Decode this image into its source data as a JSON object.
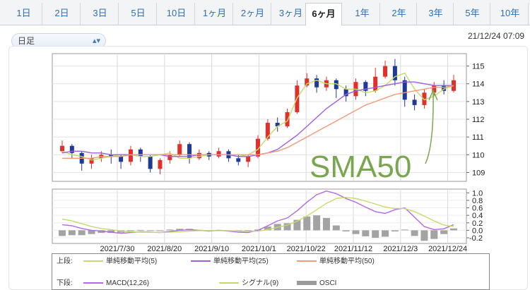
{
  "tabs": [
    {
      "label": "1日"
    },
    {
      "label": "2日"
    },
    {
      "label": "3日"
    },
    {
      "label": "5日"
    },
    {
      "label": "10日"
    },
    {
      "label": "1ヶ月"
    },
    {
      "label": "2ヶ月"
    },
    {
      "label": "3ヶ月"
    },
    {
      "label": "6ヶ月",
      "active": true
    },
    {
      "label": "1年"
    },
    {
      "label": "2年"
    },
    {
      "label": "3年"
    },
    {
      "label": "5年"
    },
    {
      "label": "10年"
    }
  ],
  "selector": {
    "value": "日足",
    "icon": "chevron-updown-icon"
  },
  "datetime": "21/12/24 07:09",
  "annotation": "SMA50",
  "legend": {
    "upper_label": "上段:",
    "lower_label": "下段:",
    "upper_items": [
      {
        "label": "単純移動平均(5)",
        "color": "#c6d96a"
      },
      {
        "label": "単純移動平均(25)",
        "color": "#9b5fe0"
      },
      {
        "label": "単純移動平均(50)",
        "color": "#f29a7a"
      }
    ],
    "lower_items": [
      {
        "label": "MACD(12,26)",
        "color": "#b36ae6"
      },
      {
        "label": "シグナル(9)",
        "color": "#c6d96a"
      },
      {
        "label": "OSCI",
        "color": "#9a9a9a"
      }
    ]
  },
  "colors": {
    "up": "#e0302a",
    "down": "#1f3a96",
    "accent": "#2f6fb5",
    "annotation": "#7aa64f"
  },
  "chart_data": [
    {
      "type": "candlestick",
      "x": [
        "2021/7/30",
        "2021/8/20",
        "2021/9/10",
        "2021/10/1",
        "2021/10/22",
        "2021/11/12",
        "2021/12/3",
        "2021/12/24"
      ],
      "ylim": [
        108.5,
        115.7
      ],
      "yticks": [
        109,
        110,
        111,
        112,
        113,
        114,
        115
      ],
      "series": [
        {
          "name": "単純移動平均(5)",
          "values": [
            110.2,
            110.0,
            109.9,
            109.7,
            109.8,
            109.9,
            110.0,
            110.0,
            109.9,
            109.9,
            110.0,
            110.1,
            109.8,
            109.8,
            109.9,
            110.0,
            110.0,
            110.0,
            109.9,
            110.0,
            110.3,
            111.0,
            111.6,
            111.9,
            113.2,
            114.0,
            114.2,
            114.0,
            114.0,
            113.7,
            113.7,
            113.5,
            113.6,
            113.9,
            114.4,
            114.6,
            113.7,
            113.1,
            113.3,
            113.7,
            113.9
          ]
        },
        {
          "name": "単純移動平均(25)",
          "values": [
            110.1,
            110.2,
            110.2,
            110.1,
            110.1,
            110.0,
            110.0,
            110.0,
            110.0,
            110.0,
            110.0,
            109.9,
            109.9,
            109.9,
            110.0,
            110.0,
            110.0,
            110.0,
            109.9,
            109.9,
            110.0,
            110.1,
            110.3,
            110.7,
            111.1,
            111.6,
            112.1,
            112.6,
            113.0,
            113.4,
            113.6,
            113.7,
            113.8,
            113.9,
            114.0,
            114.1,
            114.1,
            114.0,
            113.9,
            113.9,
            113.9
          ]
        },
        {
          "name": "単純移動平均(50)",
          "values": [
            109.8,
            109.8,
            109.8,
            109.8,
            109.9,
            109.9,
            109.9,
            110.0,
            110.0,
            110.0,
            110.0,
            110.0,
            110.0,
            110.0,
            110.0,
            110.0,
            110.0,
            110.0,
            110.0,
            110.0,
            110.0,
            110.1,
            110.2,
            110.4,
            110.7,
            111.0,
            111.3,
            111.6,
            111.9,
            112.2,
            112.5,
            112.8,
            113.0,
            113.2,
            113.4,
            113.5,
            113.6,
            113.7,
            113.8,
            113.8,
            113.9
          ]
        }
      ],
      "candles": [
        [
          110.2,
          110.5,
          110.1,
          110.8
        ],
        [
          110.5,
          110.1,
          109.8,
          110.6
        ],
        [
          110.1,
          109.5,
          109.1,
          110.2
        ],
        [
          109.5,
          109.8,
          109.2,
          110.0
        ],
        [
          109.8,
          110.0,
          109.6,
          110.2
        ],
        [
          110.0,
          109.9,
          109.5,
          110.3
        ],
        [
          109.9,
          109.6,
          109.2,
          110.0
        ],
        [
          109.6,
          110.3,
          109.4,
          110.5
        ],
        [
          110.3,
          109.9,
          109.6,
          110.4
        ],
        [
          109.9,
          109.2,
          109.0,
          110.0
        ],
        [
          109.2,
          109.7,
          108.9,
          109.8
        ],
        [
          109.7,
          110.0,
          109.5,
          110.2
        ],
        [
          110.0,
          110.6,
          109.9,
          110.8
        ],
        [
          110.6,
          109.8,
          109.5,
          110.7
        ],
        [
          109.8,
          110.1,
          109.7,
          110.3
        ],
        [
          110.1,
          109.9,
          109.7,
          110.2
        ],
        [
          109.9,
          110.2,
          109.8,
          110.4
        ],
        [
          110.2,
          109.8,
          109.6,
          110.3
        ],
        [
          109.8,
          109.6,
          109.4,
          110.0
        ],
        [
          109.6,
          109.9,
          109.3,
          110.0
        ],
        [
          109.9,
          110.9,
          109.8,
          111.1
        ],
        [
          110.9,
          111.8,
          110.8,
          112.0
        ],
        [
          111.8,
          111.6,
          111.3,
          112.1
        ],
        [
          111.6,
          112.4,
          111.5,
          112.6
        ],
        [
          112.4,
          113.9,
          112.3,
          114.2
        ],
        [
          113.9,
          114.3,
          113.8,
          114.6
        ],
        [
          114.3,
          113.8,
          113.5,
          114.5
        ],
        [
          113.8,
          114.2,
          113.6,
          114.4
        ],
        [
          114.2,
          113.7,
          113.2,
          114.3
        ],
        [
          113.7,
          113.3,
          113.0,
          113.9
        ],
        [
          113.3,
          114.1,
          113.1,
          114.3
        ],
        [
          114.1,
          113.6,
          113.3,
          114.2
        ],
        [
          113.6,
          114.4,
          113.5,
          114.9
        ],
        [
          114.4,
          115.0,
          114.3,
          115.3
        ],
        [
          115.0,
          114.2,
          113.9,
          115.4
        ],
        [
          114.2,
          113.1,
          112.7,
          114.4
        ],
        [
          113.1,
          112.8,
          112.5,
          113.4
        ],
        [
          112.8,
          113.5,
          112.6,
          113.7
        ],
        [
          113.5,
          113.9,
          113.3,
          114.1
        ],
        [
          113.9,
          113.6,
          113.4,
          114.2
        ],
        [
          113.6,
          114.2,
          113.5,
          114.5
        ]
      ]
    },
    {
      "type": "line",
      "ylim": [
        -0.35,
        1.1
      ],
      "yticks": [
        -0.2,
        0.0,
        0.2,
        0.4,
        0.6,
        0.8,
        1.0
      ],
      "series": [
        {
          "name": "MACD(12,26)",
          "values": [
            0.15,
            0.12,
            0.05,
            0.0,
            -0.02,
            -0.05,
            -0.08,
            -0.06,
            -0.04,
            -0.05,
            -0.06,
            -0.03,
            0.0,
            0.02,
            0.0,
            -0.02,
            0.0,
            -0.02,
            -0.05,
            -0.06,
            0.0,
            0.12,
            0.25,
            0.33,
            0.52,
            0.75,
            0.95,
            1.05,
            0.98,
            0.85,
            0.75,
            0.62,
            0.5,
            0.45,
            0.55,
            0.6,
            0.35,
            0.1,
            0.02,
            0.04,
            0.15
          ]
        },
        {
          "name": "シグナル(9)",
          "values": [
            0.3,
            0.25,
            0.18,
            0.1,
            0.05,
            0.02,
            -0.02,
            -0.04,
            -0.05,
            -0.05,
            -0.06,
            -0.05,
            -0.04,
            -0.02,
            -0.01,
            -0.01,
            -0.01,
            -0.01,
            -0.02,
            -0.03,
            -0.02,
            0.02,
            0.08,
            0.14,
            0.24,
            0.38,
            0.55,
            0.72,
            0.85,
            0.88,
            0.85,
            0.78,
            0.7,
            0.62,
            0.58,
            0.58,
            0.5,
            0.38,
            0.25,
            0.14,
            0.1
          ]
        },
        {
          "name": "OSCI",
          "values": [
            -0.15,
            -0.13,
            -0.13,
            -0.1,
            -0.07,
            -0.07,
            -0.06,
            -0.02,
            0.01,
            0.0,
            0.0,
            0.02,
            0.04,
            0.04,
            0.01,
            -0.01,
            0.01,
            -0.01,
            -0.03,
            -0.03,
            0.02,
            0.1,
            0.17,
            0.19,
            0.28,
            0.37,
            0.4,
            0.33,
            0.13,
            -0.03,
            -0.1,
            -0.16,
            -0.2,
            -0.17,
            -0.03,
            0.02,
            -0.15,
            -0.28,
            -0.23,
            -0.1,
            0.05
          ]
        }
      ]
    }
  ]
}
